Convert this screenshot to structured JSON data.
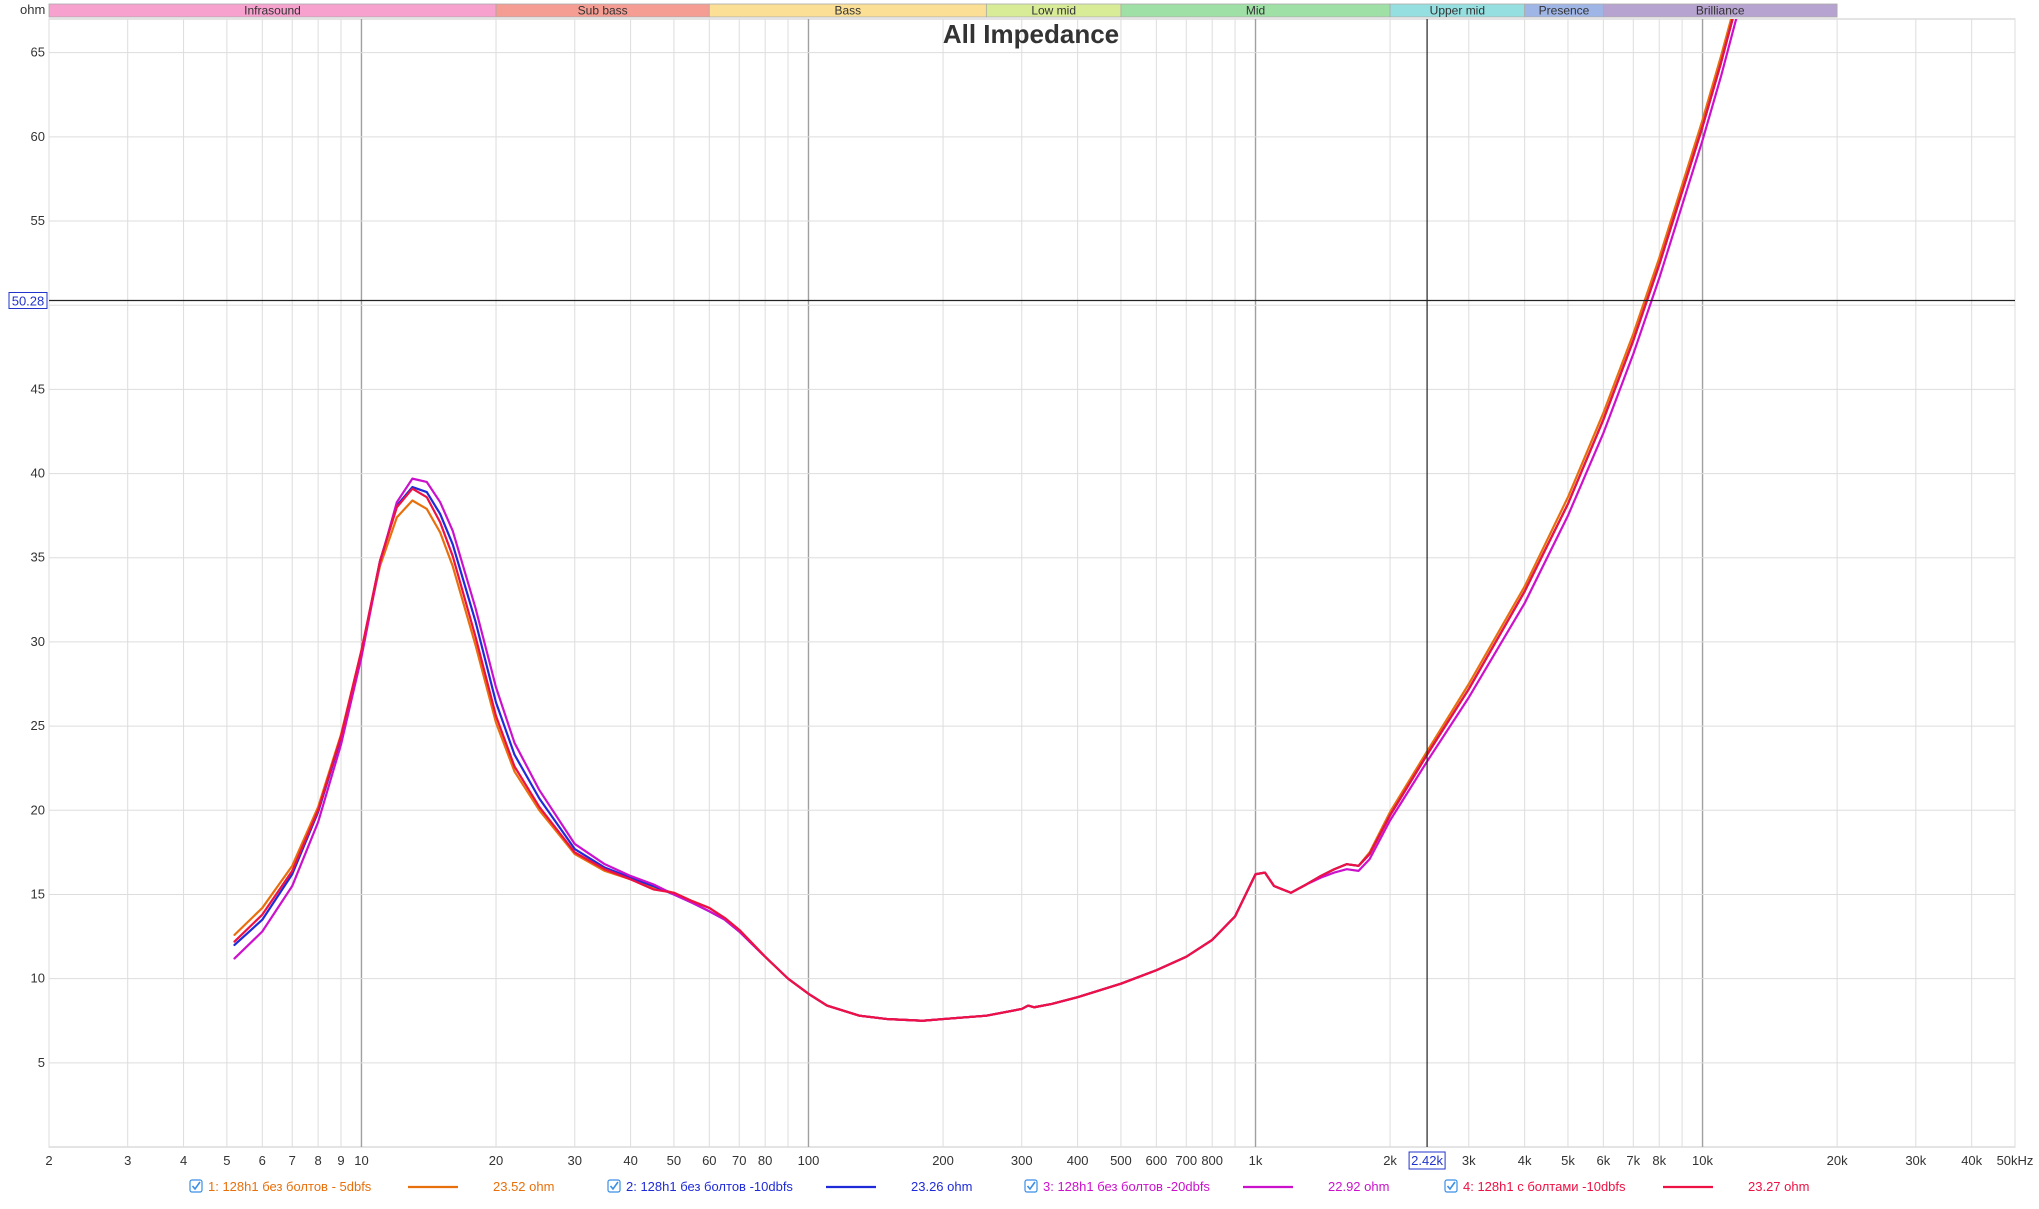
{
  "chart_data": {
    "type": "line",
    "title": "All Impedance",
    "ylabel": "ohm",
    "xscale": "log",
    "xlim": [
      2,
      50000
    ],
    "ylim": [
      0,
      67
    ],
    "grid": true,
    "y_ticks": [
      "5",
      "10",
      "15",
      "20",
      "25",
      "30",
      "35",
      "40",
      "45",
      "50",
      "55",
      "60",
      "65"
    ],
    "x_ticks": [
      {
        "v": 2,
        "label": "2"
      },
      {
        "v": 3,
        "label": "3"
      },
      {
        "v": 4,
        "label": "4"
      },
      {
        "v": 5,
        "label": "5"
      },
      {
        "v": 6,
        "label": "6"
      },
      {
        "v": 7,
        "label": "7"
      },
      {
        "v": 8,
        "label": "8"
      },
      {
        "v": 9,
        "label": "9"
      },
      {
        "v": 10,
        "label": "10"
      },
      {
        "v": 20,
        "label": "20"
      },
      {
        "v": 30,
        "label": "30"
      },
      {
        "v": 40,
        "label": "40"
      },
      {
        "v": 50,
        "label": "50"
      },
      {
        "v": 60,
        "label": "60"
      },
      {
        "v": 70,
        "label": "70"
      },
      {
        "v": 80,
        "label": "80"
      },
      {
        "v": 100,
        "label": "100"
      },
      {
        "v": 200,
        "label": "200"
      },
      {
        "v": 300,
        "label": "300"
      },
      {
        "v": 400,
        "label": "400"
      },
      {
        "v": 500,
        "label": "500"
      },
      {
        "v": 600,
        "label": "600"
      },
      {
        "v": 700,
        "label": "700"
      },
      {
        "v": 800,
        "label": "800"
      },
      {
        "v": 1000,
        "label": "1k"
      },
      {
        "v": 2000,
        "label": "2k"
      },
      {
        "v": 3000,
        "label": "3k"
      },
      {
        "v": 4000,
        "label": "4k"
      },
      {
        "v": 5000,
        "label": "5k"
      },
      {
        "v": 6000,
        "label": "6k"
      },
      {
        "v": 7000,
        "label": "7k"
      },
      {
        "v": 8000,
        "label": "8k"
      },
      {
        "v": 10000,
        "label": "10k"
      },
      {
        "v": 20000,
        "label": "20k"
      },
      {
        "v": 30000,
        "label": "30k"
      },
      {
        "v": 40000,
        "label": "40k"
      },
      {
        "v": 50000,
        "label": "50kHz"
      }
    ],
    "bands": [
      {
        "name": "Infrasound",
        "from": 2,
        "to": 20,
        "color": "#f7a1cf"
      },
      {
        "name": "Sub bass",
        "from": 20,
        "to": 60,
        "color": "#f59c93"
      },
      {
        "name": "Bass",
        "from": 60,
        "to": 250,
        "color": "#fbdf94"
      },
      {
        "name": "Low mid",
        "from": 250,
        "to": 500,
        "color": "#d8ec98"
      },
      {
        "name": "Mid",
        "from": 500,
        "to": 2000,
        "color": "#9fe0a6"
      },
      {
        "name": "Upper mid",
        "from": 2000,
        "to": 4000,
        "color": "#95dfe0"
      },
      {
        "name": "Presence",
        "from": 4000,
        "to": 6000,
        "color": "#9fb5e6"
      },
      {
        "name": "Brilliance",
        "from": 6000,
        "to": 20000,
        "color": "#b7a3d0"
      }
    ],
    "cursor": {
      "x": 2420,
      "y": 50.28,
      "x_label": "2.42k",
      "y_label": "50.28"
    },
    "series": [
      {
        "name": "1: 128h1 без болтов - 5dbfs",
        "color": "#e8700c",
        "cursor_value": "23.52 ohm",
        "points": [
          [
            5.2,
            12.6
          ],
          [
            6,
            14.2
          ],
          [
            7,
            16.7
          ],
          [
            8,
            20.2
          ],
          [
            9,
            24.5
          ],
          [
            10,
            29.5
          ],
          [
            11,
            34.5
          ],
          [
            12,
            37.4
          ],
          [
            13,
            38.4
          ],
          [
            14,
            37.9
          ],
          [
            15,
            36.5
          ],
          [
            16,
            34.5
          ],
          [
            18,
            29.8
          ],
          [
            20,
            25.2
          ],
          [
            22,
            22.3
          ],
          [
            25,
            20.0
          ],
          [
            30,
            17.4
          ],
          [
            35,
            16.4
          ],
          [
            40,
            15.9
          ],
          [
            45,
            15.4
          ],
          [
            50,
            15.1
          ],
          [
            55,
            14.6
          ],
          [
            60,
            14.2
          ],
          [
            65,
            13.6
          ],
          [
            70,
            12.9
          ],
          [
            80,
            11.3
          ],
          [
            90,
            10.0
          ],
          [
            100,
            9.1
          ],
          [
            110,
            8.4
          ],
          [
            130,
            7.8
          ],
          [
            150,
            7.6
          ],
          [
            180,
            7.5
          ],
          [
            200,
            7.6
          ],
          [
            250,
            7.8
          ],
          [
            300,
            8.2
          ],
          [
            310,
            8.4
          ],
          [
            320,
            8.3
          ],
          [
            350,
            8.5
          ],
          [
            400,
            8.9
          ],
          [
            500,
            9.7
          ],
          [
            600,
            10.5
          ],
          [
            700,
            11.3
          ],
          [
            800,
            12.3
          ],
          [
            900,
            13.7
          ],
          [
            1000,
            16.2
          ],
          [
            1050,
            16.3
          ],
          [
            1100,
            15.5
          ],
          [
            1200,
            15.1
          ],
          [
            1300,
            15.6
          ],
          [
            1400,
            16.1
          ],
          [
            1500,
            16.5
          ],
          [
            1600,
            16.8
          ],
          [
            1700,
            16.7
          ],
          [
            1800,
            17.5
          ],
          [
            2000,
            19.9
          ],
          [
            2420,
            23.5
          ],
          [
            3000,
            27.5
          ],
          [
            4000,
            33.3
          ],
          [
            5000,
            38.6
          ],
          [
            6000,
            43.6
          ],
          [
            7000,
            48.3
          ],
          [
            8000,
            52.8
          ],
          [
            10000,
            61.0
          ],
          [
            11000,
            64.8
          ],
          [
            12000,
            68.5
          ]
        ]
      },
      {
        "name": "2: 128h1 без болтов -10dbfs",
        "color": "#1f2bd8",
        "cursor_value": "23.26 ohm",
        "points": [
          [
            5.2,
            12.0
          ],
          [
            6,
            13.5
          ],
          [
            7,
            16.2
          ],
          [
            8,
            19.9
          ],
          [
            9,
            24.3
          ],
          [
            10,
            29.4
          ],
          [
            11,
            34.8
          ],
          [
            12,
            38.1
          ],
          [
            13,
            39.2
          ],
          [
            14,
            38.9
          ],
          [
            15,
            37.6
          ],
          [
            16,
            35.8
          ],
          [
            18,
            31.2
          ],
          [
            20,
            26.4
          ],
          [
            22,
            23.3
          ],
          [
            25,
            20.7
          ],
          [
            30,
            17.7
          ],
          [
            35,
            16.6
          ],
          [
            40,
            16.0
          ],
          [
            45,
            15.5
          ],
          [
            50,
            15.0
          ],
          [
            55,
            14.5
          ],
          [
            60,
            14.0
          ],
          [
            65,
            13.5
          ],
          [
            70,
            12.8
          ],
          [
            80,
            11.3
          ],
          [
            90,
            10.0
          ],
          [
            100,
            9.1
          ],
          [
            110,
            8.4
          ],
          [
            130,
            7.8
          ],
          [
            150,
            7.6
          ],
          [
            180,
            7.5
          ],
          [
            200,
            7.6
          ],
          [
            250,
            7.8
          ],
          [
            300,
            8.2
          ],
          [
            310,
            8.4
          ],
          [
            320,
            8.3
          ],
          [
            350,
            8.5
          ],
          [
            400,
            8.9
          ],
          [
            500,
            9.7
          ],
          [
            600,
            10.5
          ],
          [
            700,
            11.3
          ],
          [
            800,
            12.3
          ],
          [
            900,
            13.7
          ],
          [
            1000,
            16.2
          ],
          [
            1050,
            16.3
          ],
          [
            1100,
            15.5
          ],
          [
            1200,
            15.1
          ],
          [
            1300,
            15.6
          ],
          [
            1400,
            16.1
          ],
          [
            1500,
            16.5
          ],
          [
            1600,
            16.8
          ],
          [
            1700,
            16.7
          ],
          [
            1800,
            17.4
          ],
          [
            2000,
            19.7
          ],
          [
            2420,
            23.3
          ],
          [
            3000,
            27.2
          ],
          [
            4000,
            33.0
          ],
          [
            5000,
            38.2
          ],
          [
            6000,
            43.2
          ],
          [
            7000,
            47.9
          ],
          [
            8000,
            52.4
          ],
          [
            10000,
            60.6
          ],
          [
            11000,
            64.4
          ],
          [
            12000,
            68.2
          ]
        ]
      },
      {
        "name": "3: 128h1 без болтов -20dbfs",
        "color": "#cc11cc",
        "cursor_value": "22.92 ohm",
        "points": [
          [
            5.2,
            11.2
          ],
          [
            6,
            12.8
          ],
          [
            7,
            15.5
          ],
          [
            8,
            19.3
          ],
          [
            9,
            23.9
          ],
          [
            10,
            29.1
          ],
          [
            11,
            34.7
          ],
          [
            12,
            38.3
          ],
          [
            13,
            39.7
          ],
          [
            14,
            39.5
          ],
          [
            15,
            38.3
          ],
          [
            16,
            36.6
          ],
          [
            18,
            32.0
          ],
          [
            20,
            27.3
          ],
          [
            22,
            24.0
          ],
          [
            25,
            21.2
          ],
          [
            30,
            18.0
          ],
          [
            35,
            16.8
          ],
          [
            40,
            16.1
          ],
          [
            45,
            15.6
          ],
          [
            50,
            15.0
          ],
          [
            55,
            14.5
          ],
          [
            60,
            14.0
          ],
          [
            65,
            13.5
          ],
          [
            70,
            12.8
          ],
          [
            80,
            11.3
          ],
          [
            90,
            10.0
          ],
          [
            100,
            9.1
          ],
          [
            110,
            8.4
          ],
          [
            130,
            7.8
          ],
          [
            150,
            7.6
          ],
          [
            180,
            7.5
          ],
          [
            200,
            7.6
          ],
          [
            250,
            7.8
          ],
          [
            300,
            8.2
          ],
          [
            310,
            8.4
          ],
          [
            320,
            8.3
          ],
          [
            350,
            8.5
          ],
          [
            400,
            8.9
          ],
          [
            500,
            9.7
          ],
          [
            600,
            10.5
          ],
          [
            700,
            11.3
          ],
          [
            800,
            12.3
          ],
          [
            900,
            13.7
          ],
          [
            1000,
            16.2
          ],
          [
            1050,
            16.3
          ],
          [
            1100,
            15.5
          ],
          [
            1200,
            15.1
          ],
          [
            1300,
            15.6
          ],
          [
            1400,
            16.0
          ],
          [
            1500,
            16.3
          ],
          [
            1600,
            16.5
          ],
          [
            1700,
            16.4
          ],
          [
            1800,
            17.1
          ],
          [
            2000,
            19.4
          ],
          [
            2420,
            22.9
          ],
          [
            3000,
            26.7
          ],
          [
            4000,
            32.3
          ],
          [
            5000,
            37.5
          ],
          [
            6000,
            42.4
          ],
          [
            7000,
            47.1
          ],
          [
            8000,
            51.6
          ],
          [
            10000,
            59.8
          ],
          [
            11000,
            63.6
          ],
          [
            12000,
            67.4
          ]
        ]
      },
      {
        "name": "4: 128h1 с болтами -10dbfs",
        "color": "#ee1144",
        "cursor_value": "23.27 ohm",
        "points": [
          [
            5.2,
            12.2
          ],
          [
            6,
            13.8
          ],
          [
            7,
            16.4
          ],
          [
            8,
            20.0
          ],
          [
            9,
            24.4
          ],
          [
            10,
            29.5
          ],
          [
            11,
            34.8
          ],
          [
            12,
            38.0
          ],
          [
            13,
            39.1
          ],
          [
            14,
            38.6
          ],
          [
            15,
            37.1
          ],
          [
            16,
            35.1
          ],
          [
            18,
            30.3
          ],
          [
            20,
            25.6
          ],
          [
            22,
            22.6
          ],
          [
            25,
            20.2
          ],
          [
            30,
            17.5
          ],
          [
            35,
            16.5
          ],
          [
            40,
            15.9
          ],
          [
            45,
            15.3
          ],
          [
            50,
            15.1
          ],
          [
            55,
            14.6
          ],
          [
            60,
            14.2
          ],
          [
            65,
            13.6
          ],
          [
            70,
            12.9
          ],
          [
            80,
            11.3
          ],
          [
            90,
            10.0
          ],
          [
            100,
            9.1
          ],
          [
            110,
            8.4
          ],
          [
            130,
            7.8
          ],
          [
            150,
            7.6
          ],
          [
            180,
            7.5
          ],
          [
            200,
            7.6
          ],
          [
            250,
            7.8
          ],
          [
            300,
            8.2
          ],
          [
            310,
            8.4
          ],
          [
            320,
            8.3
          ],
          [
            350,
            8.5
          ],
          [
            400,
            8.9
          ],
          [
            500,
            9.7
          ],
          [
            600,
            10.5
          ],
          [
            700,
            11.3
          ],
          [
            800,
            12.3
          ],
          [
            900,
            13.7
          ],
          [
            1000,
            16.2
          ],
          [
            1050,
            16.3
          ],
          [
            1100,
            15.5
          ],
          [
            1200,
            15.1
          ],
          [
            1300,
            15.6
          ],
          [
            1400,
            16.1
          ],
          [
            1500,
            16.5
          ],
          [
            1600,
            16.8
          ],
          [
            1700,
            16.7
          ],
          [
            1800,
            17.4
          ],
          [
            2000,
            19.7
          ],
          [
            2420,
            23.3
          ],
          [
            3000,
            27.2
          ],
          [
            4000,
            33.0
          ],
          [
            5000,
            38.2
          ],
          [
            6000,
            43.2
          ],
          [
            7000,
            47.9
          ],
          [
            8000,
            52.4
          ],
          [
            10000,
            60.6
          ],
          [
            11000,
            64.4
          ],
          [
            12000,
            68.2
          ]
        ]
      }
    ]
  }
}
